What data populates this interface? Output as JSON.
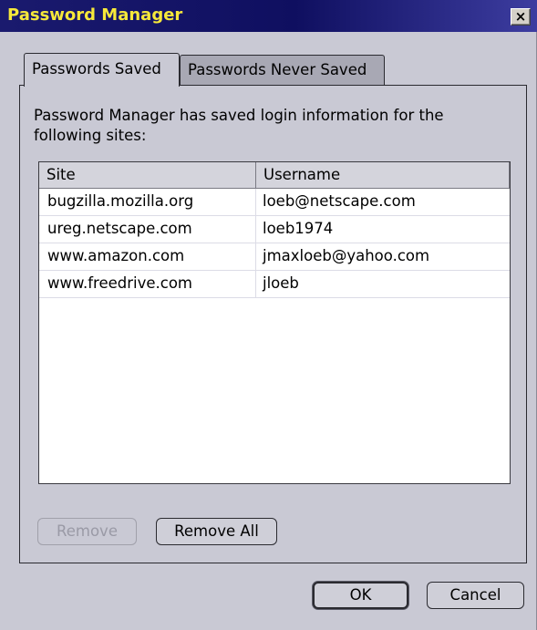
{
  "window": {
    "title": "Password Manager",
    "close_label": "×"
  },
  "tabs": [
    {
      "label": "Passwords Saved",
      "active": true
    },
    {
      "label": "Passwords Never Saved",
      "active": false
    }
  ],
  "description": "Password Manager has saved login information for the following sites:",
  "table": {
    "columns": [
      "Site",
      "Username"
    ],
    "rows": [
      [
        "bugzilla.mozilla.org",
        "loeb@netscape.com"
      ],
      [
        "ureg.netscape.com",
        "loeb1974"
      ],
      [
        "www.amazon.com",
        "jmaxloeb@yahoo.com"
      ],
      [
        "www.freedrive.com",
        "jloeb"
      ]
    ]
  },
  "buttons": {
    "remove": "Remove",
    "remove_all": "Remove All",
    "ok": "OK",
    "cancel": "Cancel"
  },
  "colors": {
    "title_text": "#f6e83a",
    "titlebar": "#1a1a6e",
    "window_bg": "#c9c9d4"
  }
}
